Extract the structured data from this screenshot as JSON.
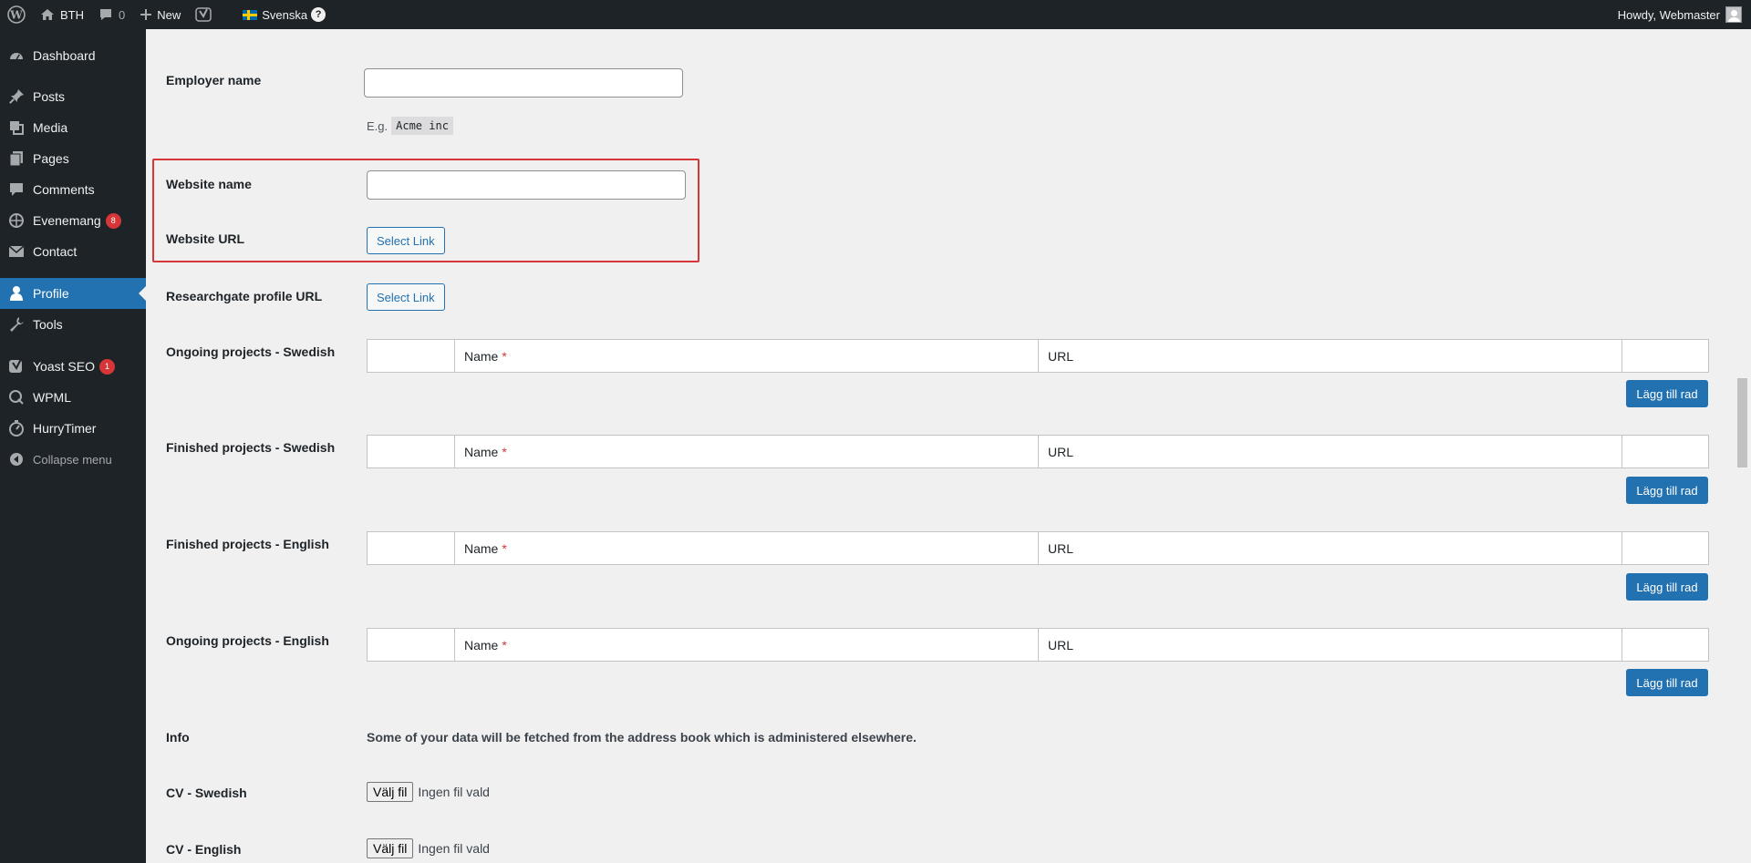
{
  "adminbar": {
    "site_name": "BTH",
    "comments_count": "0",
    "new_label": "New",
    "language": "Svenska",
    "language_help": "?",
    "greeting": "Howdy, Webmaster"
  },
  "sidebar": {
    "items": [
      {
        "label": "Dashboard",
        "icon": "dashboard-icon"
      },
      {
        "label": "Posts",
        "icon": "pin-icon"
      },
      {
        "label": "Media",
        "icon": "media-icon"
      },
      {
        "label": "Pages",
        "icon": "pages-icon"
      },
      {
        "label": "Comments",
        "icon": "comment-icon"
      },
      {
        "label": "Evenemang",
        "icon": "calendar-icon",
        "badge": "8"
      },
      {
        "label": "Contact",
        "icon": "mail-icon"
      },
      {
        "label": "Profile",
        "icon": "user-icon",
        "active": true
      },
      {
        "label": "Tools",
        "icon": "wrench-icon"
      },
      {
        "label": "Yoast SEO",
        "icon": "yoast-icon",
        "badge": "1"
      },
      {
        "label": "WPML",
        "icon": "wpml-icon"
      },
      {
        "label": "HurryTimer",
        "icon": "timer-icon"
      },
      {
        "label": "Collapse menu",
        "icon": "collapse-icon"
      }
    ]
  },
  "form": {
    "employer_name": {
      "label": "Employer name",
      "value": "",
      "hint_prefix": "E.g.",
      "hint_code": "Acme inc"
    },
    "website_name": {
      "label": "Website name",
      "value": ""
    },
    "website_url": {
      "label": "Website URL",
      "button": "Select Link"
    },
    "researchgate": {
      "label": "Researchgate profile URL",
      "button": "Select Link"
    },
    "repeaters": [
      {
        "label": "Ongoing projects - Swedish",
        "col_name": "Name",
        "required": "*",
        "col_url": "URL",
        "add_button": "Lägg till rad"
      },
      {
        "label": "Finished projects - Swedish",
        "col_name": "Name",
        "required": "*",
        "col_url": "URL",
        "add_button": "Lägg till rad"
      },
      {
        "label": "Finished projects - English",
        "col_name": "Name",
        "required": "*",
        "col_url": "URL",
        "add_button": "Lägg till rad"
      },
      {
        "label": "Ongoing projects - English",
        "col_name": "Name",
        "required": "*",
        "col_url": "URL",
        "add_button": "Lägg till rad"
      }
    ],
    "info": {
      "label": "Info",
      "text": "Some of your data will be fetched from the address book which is administered elsewhere."
    },
    "cv_swedish": {
      "label": "CV - Swedish",
      "button": "Välj fil",
      "status": "Ingen fil vald"
    },
    "cv_english": {
      "label": "CV - English",
      "button": "Välj fil",
      "status": "Ingen fil vald"
    }
  },
  "colors": {
    "accent": "#2271b1",
    "sidebar_bg": "#1d2327",
    "highlight": "#d63638"
  }
}
